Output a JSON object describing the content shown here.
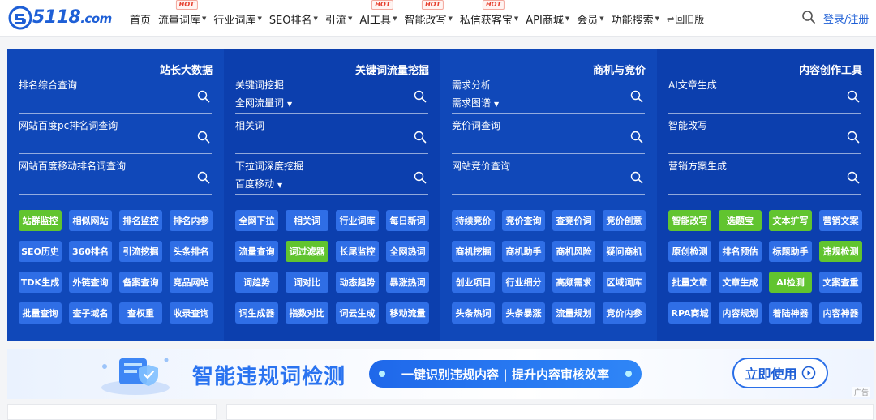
{
  "header": {
    "logo_text": "5118",
    "logo_suffix": ".com",
    "nav": [
      {
        "label": "首页",
        "dropdown": false,
        "hot": ""
      },
      {
        "label": "流量词库",
        "dropdown": true,
        "hot": "HOT"
      },
      {
        "label": "行业词库",
        "dropdown": true,
        "hot": ""
      },
      {
        "label": "SEO排名",
        "dropdown": true,
        "hot": ""
      },
      {
        "label": "引流",
        "dropdown": true,
        "hot": ""
      },
      {
        "label": "AI工具",
        "dropdown": true,
        "hot": "HOT"
      },
      {
        "label": "智能改写",
        "dropdown": true,
        "hot": "HOT"
      },
      {
        "label": "私信获客宝",
        "dropdown": true,
        "hot": "HOT"
      },
      {
        "label": "API商城",
        "dropdown": true,
        "hot": ""
      },
      {
        "label": "会员",
        "dropdown": true,
        "hot": ""
      },
      {
        "label": "功能搜索",
        "dropdown": true,
        "hot": ""
      }
    ],
    "old_version": "回旧版",
    "login": "登录/注册",
    "caret_glyph": "▼",
    "arrow_glyph": "⇌"
  },
  "tools": {
    "columns": [
      {
        "title": "站长大数据",
        "fields": [
          {
            "label": "排名综合查询",
            "sub": ""
          },
          {
            "label": "网站百度pc排名词查询",
            "sub": ""
          },
          {
            "label": "网站百度移动排名词查询",
            "sub": ""
          }
        ],
        "buttons": [
          {
            "label": "站群监控",
            "green": true
          },
          {
            "label": "相似网站",
            "green": false
          },
          {
            "label": "排名监控",
            "green": false
          },
          {
            "label": "排名内参",
            "green": false
          },
          {
            "label": "SEO历史",
            "green": false
          },
          {
            "label": "360排名",
            "green": false
          },
          {
            "label": "引流挖掘",
            "green": false
          },
          {
            "label": "头条排名",
            "green": false
          },
          {
            "label": "TDK生成",
            "green": false
          },
          {
            "label": "外链查询",
            "green": false
          },
          {
            "label": "备案查询",
            "green": false
          },
          {
            "label": "竞品网站",
            "green": false
          },
          {
            "label": "批量查询",
            "green": false
          },
          {
            "label": "查子域名",
            "green": false
          },
          {
            "label": "查权重",
            "green": false
          },
          {
            "label": "收录查询",
            "green": false
          }
        ]
      },
      {
        "title": "关键词流量挖掘",
        "fields": [
          {
            "label": "关键词挖掘",
            "sub": "全网流量词"
          },
          {
            "label": "相关词",
            "sub": ""
          },
          {
            "label": "下拉词深度挖掘",
            "sub": "百度移动"
          }
        ],
        "buttons": [
          {
            "label": "全网下拉",
            "green": false
          },
          {
            "label": "相关词",
            "green": false
          },
          {
            "label": "行业词库",
            "green": false
          },
          {
            "label": "每日新词",
            "green": false
          },
          {
            "label": "流量查询",
            "green": false
          },
          {
            "label": "词过滤器",
            "green": true
          },
          {
            "label": "长尾监控",
            "green": false
          },
          {
            "label": "全网热词",
            "green": false
          },
          {
            "label": "词趋势",
            "green": false
          },
          {
            "label": "词对比",
            "green": false
          },
          {
            "label": "动态趋势",
            "green": false
          },
          {
            "label": "暴涨热词",
            "green": false
          },
          {
            "label": "词生成器",
            "green": false
          },
          {
            "label": "指数对比",
            "green": false
          },
          {
            "label": "词云生成",
            "green": false
          },
          {
            "label": "移动流量",
            "green": false
          }
        ]
      },
      {
        "title": "商机与竞价",
        "fields": [
          {
            "label": "需求分析",
            "sub": "需求图谱"
          },
          {
            "label": "竞价词查询",
            "sub": ""
          },
          {
            "label": "网站竞价查询",
            "sub": ""
          }
        ],
        "buttons": [
          {
            "label": "持续竞价",
            "green": false
          },
          {
            "label": "竞价查询",
            "green": false
          },
          {
            "label": "查竞价词",
            "green": false
          },
          {
            "label": "竞价创意",
            "green": false
          },
          {
            "label": "商机挖掘",
            "green": false
          },
          {
            "label": "商机助手",
            "green": false
          },
          {
            "label": "商机风险",
            "green": false
          },
          {
            "label": "疑问商机",
            "green": false
          },
          {
            "label": "创业项目",
            "green": false
          },
          {
            "label": "行业细分",
            "green": false
          },
          {
            "label": "高频需求",
            "green": false
          },
          {
            "label": "区域词库",
            "green": false
          },
          {
            "label": "头条热词",
            "green": false
          },
          {
            "label": "头条暴涨",
            "green": false
          },
          {
            "label": "流量规划",
            "green": false
          },
          {
            "label": "竞价内参",
            "green": false
          }
        ]
      },
      {
        "title": "内容创作工具",
        "fields": [
          {
            "label": "AI文章生成",
            "sub": ""
          },
          {
            "label": "智能改写",
            "sub": ""
          },
          {
            "label": "营销方案生成",
            "sub": ""
          }
        ],
        "buttons": [
          {
            "label": "智能改写",
            "green": true
          },
          {
            "label": "选题宝",
            "green": true
          },
          {
            "label": "文本扩写",
            "green": true
          },
          {
            "label": "营销文案",
            "green": false
          },
          {
            "label": "原创检测",
            "green": false
          },
          {
            "label": "排名预估",
            "green": false
          },
          {
            "label": "标题助手",
            "green": false
          },
          {
            "label": "违规检测",
            "green": true
          },
          {
            "label": "批量文章",
            "green": false
          },
          {
            "label": "文章生成",
            "green": false
          },
          {
            "label": "AI检测",
            "green": true
          },
          {
            "label": "文案查重",
            "green": false
          },
          {
            "label": "RPA商城",
            "green": false
          },
          {
            "label": "内容规划",
            "green": false
          },
          {
            "label": "着陆神器",
            "green": false
          },
          {
            "label": "内容神器",
            "green": false
          }
        ]
      }
    ]
  },
  "banner": {
    "title": "智能违规词检测",
    "slogan": "一键识别违规内容 | 提升内容审核效率",
    "cta": "立即使用",
    "ad_tag": "广告"
  },
  "colors": {
    "brand": "#1e5fd6",
    "panel": "#1048b9",
    "button": "#2f6ee6",
    "button_green": "#61c42f",
    "hot": "#e6402e"
  }
}
